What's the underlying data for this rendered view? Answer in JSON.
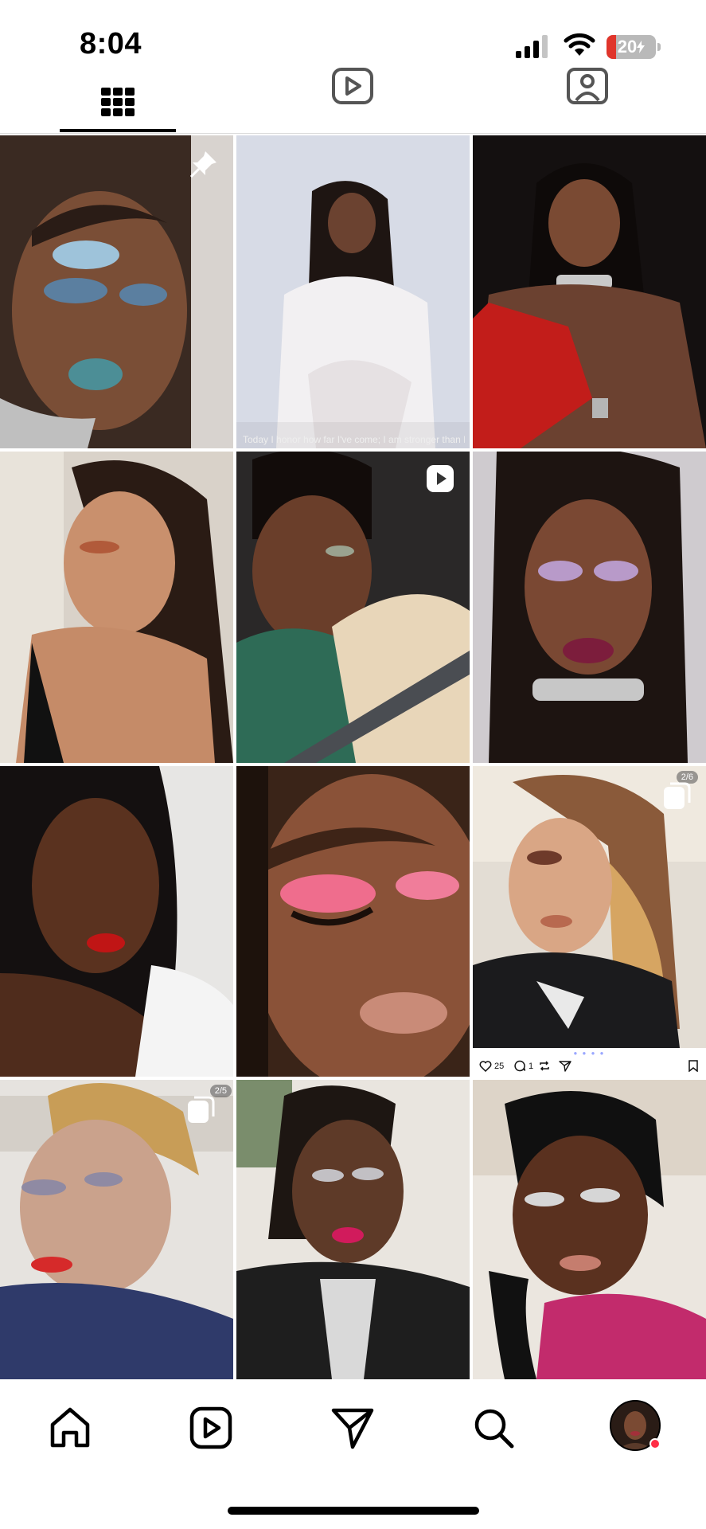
{
  "status_bar": {
    "time": "8:04",
    "battery_text": "20",
    "battery_level_percent": 20,
    "battery_color": "#e0352b",
    "icons": [
      "cellular-signal-icon",
      "wifi-icon",
      "battery-charging-icon"
    ]
  },
  "profile_tabs": {
    "items": [
      {
        "icon": "grid-icon",
        "selected": true
      },
      {
        "icon": "reels-icon",
        "selected": false
      },
      {
        "icon": "tagged-icon",
        "selected": false
      }
    ]
  },
  "grid": {
    "posts": [
      {
        "kind": "pinned",
        "icon": "pin-icon"
      },
      {
        "kind": "photo",
        "caption": "Today I honor how far I've come; I am stronger than I"
      },
      {
        "kind": "photo"
      },
      {
        "kind": "photo"
      },
      {
        "kind": "reel",
        "icon": "reel-play-icon"
      },
      {
        "kind": "photo"
      },
      {
        "kind": "photo"
      },
      {
        "kind": "photo"
      },
      {
        "kind": "carousel",
        "icon": "carousel-icon",
        "count": "2/6",
        "likes": "25",
        "comments": "1"
      },
      {
        "kind": "carousel",
        "icon": "carousel-icon",
        "count": "2/5"
      },
      {
        "kind": "photo"
      },
      {
        "kind": "photo"
      }
    ]
  },
  "bottom_nav": {
    "items": [
      "home-icon",
      "reels-icon",
      "send-icon",
      "search-icon",
      "profile-avatar"
    ],
    "notification_dot_color": "#ff2d46"
  }
}
